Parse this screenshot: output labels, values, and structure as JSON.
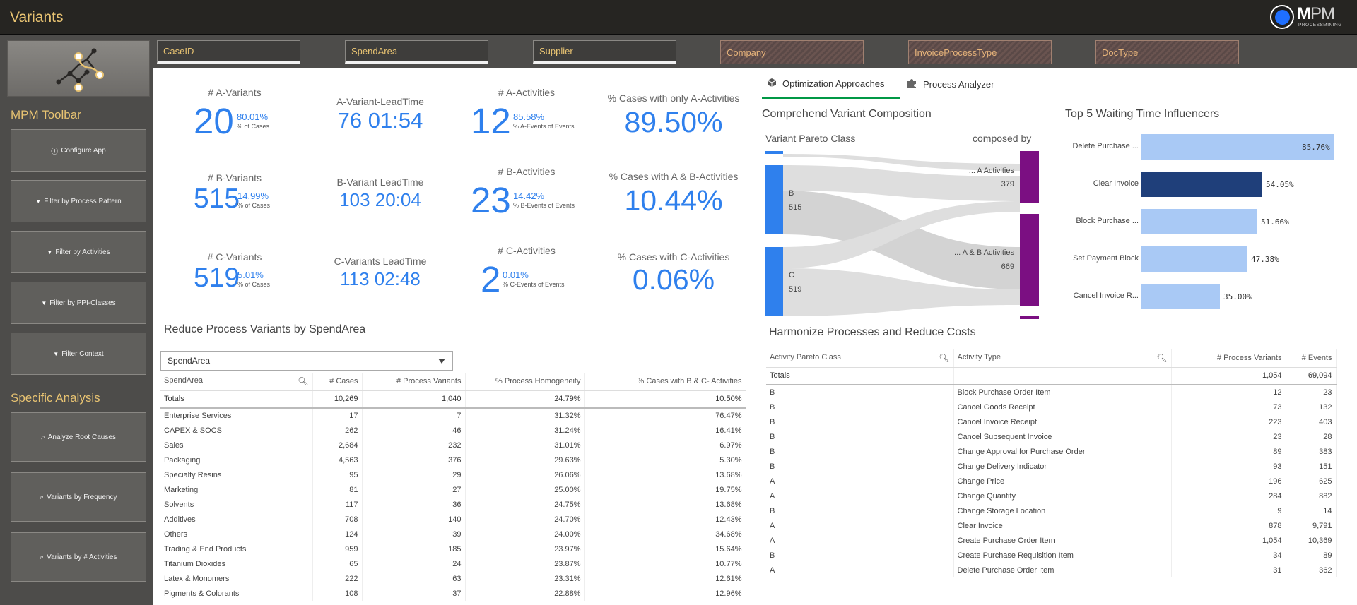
{
  "app": {
    "title": "Variants"
  },
  "logo": {
    "brand_m": "M",
    "brand_pm": "PM",
    "subtitle": "PROCESSMINING"
  },
  "filters": [
    {
      "label": "CaseID",
      "state": "on"
    },
    {
      "label": "SpendArea",
      "state": "on"
    },
    {
      "label": "Supplier",
      "state": "on"
    },
    {
      "label": "Company",
      "state": "off"
    },
    {
      "label": "InvoiceProcessType",
      "state": "off"
    },
    {
      "label": "DocType",
      "state": "off"
    }
  ],
  "sidebar": {
    "toolbar_heading": "MPM Toolbar",
    "toolbar_buttons": [
      {
        "icon": "info-icon",
        "label": "Configure App"
      },
      {
        "icon": "filter-icon",
        "label": "Filter by Process Pattern"
      },
      {
        "icon": "filter-icon",
        "label": "Filter by Activities"
      },
      {
        "icon": "filter-icon",
        "label": "Filter by PPI-Classes"
      },
      {
        "icon": "filter-icon",
        "label": "Filter Context"
      }
    ],
    "analysis_heading": "Specific Analysis",
    "analysis_buttons": [
      {
        "icon": "search-icon",
        "label": "Analyze Root Causes"
      },
      {
        "icon": "search-icon",
        "label": "Variants by Frequency"
      },
      {
        "icon": "search-icon",
        "label": "Variants by # Activities"
      }
    ]
  },
  "kpis": {
    "a_variants": {
      "label": "# A-Variants",
      "value": "20",
      "pct": "80.01%",
      "sub": "% of Cases"
    },
    "b_variants": {
      "label": "# B-Variants",
      "value": "515",
      "pct": "14.99%",
      "sub": "% of Cases"
    },
    "c_variants": {
      "label": "# C-Variants",
      "value": "519",
      "pct": "5.01%",
      "sub": "% of Cases"
    },
    "a_leadtime": {
      "label": "A-Variant-LeadTime",
      "value": "76 01:54"
    },
    "b_leadtime": {
      "label": "B-Variant LeadTime",
      "value": "103 20:04"
    },
    "c_leadtime": {
      "label": "C-Variants LeadTime",
      "value": "113 02:48"
    },
    "a_activities": {
      "label": "# A-Activities",
      "value": "12",
      "pct": "85.58%",
      "sub": "% A-Events of Events"
    },
    "b_activities": {
      "label": "# B-Activities",
      "value": "23",
      "pct": "14.42%",
      "sub": "% B-Events of Events"
    },
    "c_activities": {
      "label": "# C-Activities",
      "value": "2",
      "pct": "0.01%",
      "sub": "% C-Events of Events"
    },
    "only_a": {
      "label": "% Cases with only A-Activities",
      "value": "89.50%"
    },
    "a_and_b": {
      "label": "% Cases with A & B-Activities",
      "value": "10.44%"
    },
    "with_c": {
      "label": "% Cases with C-Activities",
      "value": "0.06%"
    }
  },
  "tabs": [
    {
      "label": "Optimization Approaches",
      "icon": "cube-icon",
      "active": true
    },
    {
      "label": "Process Analyzer",
      "icon": "puzzle-icon",
      "active": false
    }
  ],
  "composition": {
    "title": "Comprehend Variant Composition",
    "left_header": "Variant Pareto Class",
    "right_header": "composed by",
    "left_nodes": [
      {
        "label": "B",
        "value": "515"
      },
      {
        "label": "C",
        "value": "519"
      }
    ],
    "right_nodes": [
      {
        "label": "... A Activities",
        "value": "379"
      },
      {
        "label": "... A & B Activities",
        "value": "669"
      }
    ],
    "colors": {
      "left": "#2f80ed",
      "right": "#7b0f82",
      "flow": "#d9d9d9"
    }
  },
  "waiting": {
    "title": "Top 5 Waiting Time Influencers",
    "items": [
      {
        "label": "Delete Purchase ...",
        "value": 85.76,
        "display": "85.76%",
        "color": "#a9c9f5"
      },
      {
        "label": "Clear Invoice",
        "value": 54.05,
        "display": "54.05%",
        "color": "#1f3f7a"
      },
      {
        "label": "Block Purchase ...",
        "value": 51.66,
        "display": "51.66%",
        "color": "#a9c9f5"
      },
      {
        "label": "Set Payment Block",
        "value": 47.38,
        "display": "47.38%",
        "color": "#a9c9f5"
      },
      {
        "label": "Cancel Invoice R...",
        "value": 35.0,
        "display": "35.00%",
        "color": "#a9c9f5"
      }
    ]
  },
  "spend": {
    "title": "Reduce Process Variants by SpendArea",
    "dropdown": "SpendArea",
    "headers": [
      "SpendArea",
      "# Cases",
      "# Process Variants",
      "% Process Homogeneity",
      "% Cases with B & C- Activities"
    ],
    "totals": [
      "Totals",
      "10,269",
      "1,040",
      "24.79%",
      "10.50%"
    ],
    "rows": [
      [
        "Enterprise Services",
        "17",
        "7",
        "31.32%",
        "76.47%"
      ],
      [
        "CAPEX & SOCS",
        "262",
        "46",
        "31.24%",
        "16.41%"
      ],
      [
        "Sales",
        "2,684",
        "232",
        "31.01%",
        "6.97%"
      ],
      [
        "Packaging",
        "4,563",
        "376",
        "29.63%",
        "5.30%"
      ],
      [
        "Specialty Resins",
        "95",
        "29",
        "26.06%",
        "13.68%"
      ],
      [
        "Marketing",
        "81",
        "27",
        "25.00%",
        "19.75%"
      ],
      [
        "Solvents",
        "117",
        "36",
        "24.75%",
        "13.68%"
      ],
      [
        "Additives",
        "708",
        "140",
        "24.70%",
        "12.43%"
      ],
      [
        "Others",
        "124",
        "39",
        "24.00%",
        "34.68%"
      ],
      [
        "Trading & End Products",
        "959",
        "185",
        "23.97%",
        "15.64%"
      ],
      [
        "Titanium Dioxides",
        "65",
        "24",
        "23.87%",
        "10.77%"
      ],
      [
        "Latex & Monomers",
        "222",
        "63",
        "23.31%",
        "12.61%"
      ],
      [
        "Pigments & Colorants",
        "108",
        "37",
        "22.88%",
        "12.96%"
      ]
    ]
  },
  "harmonize": {
    "title": "Harmonize Processes and Reduce Costs",
    "headers": [
      "Activity Pareto Class",
      "Activity Type",
      "# Process Variants",
      "# Events"
    ],
    "totals": [
      "Totals",
      "",
      "1,054",
      "69,094"
    ],
    "rows": [
      [
        "B",
        "Block Purchase Order Item",
        "12",
        "23"
      ],
      [
        "B",
        "Cancel Goods Receipt",
        "73",
        "132"
      ],
      [
        "B",
        "Cancel Invoice Receipt",
        "223",
        "403"
      ],
      [
        "B",
        "Cancel Subsequent Invoice",
        "23",
        "28"
      ],
      [
        "B",
        "Change Approval for Purchase Order",
        "89",
        "383"
      ],
      [
        "B",
        "Change Delivery Indicator",
        "93",
        "151"
      ],
      [
        "A",
        "Change Price",
        "196",
        "625"
      ],
      [
        "A",
        "Change Quantity",
        "284",
        "882"
      ],
      [
        "B",
        "Change Storage Location",
        "9",
        "14"
      ],
      [
        "A",
        "Clear Invoice",
        "878",
        "9,791"
      ],
      [
        "A",
        "Create Purchase Order Item",
        "1,054",
        "10,369"
      ],
      [
        "B",
        "Create Purchase Requisition Item",
        "34",
        "89"
      ],
      [
        "A",
        "Delete Purchase Order Item",
        "31",
        "362"
      ]
    ]
  }
}
